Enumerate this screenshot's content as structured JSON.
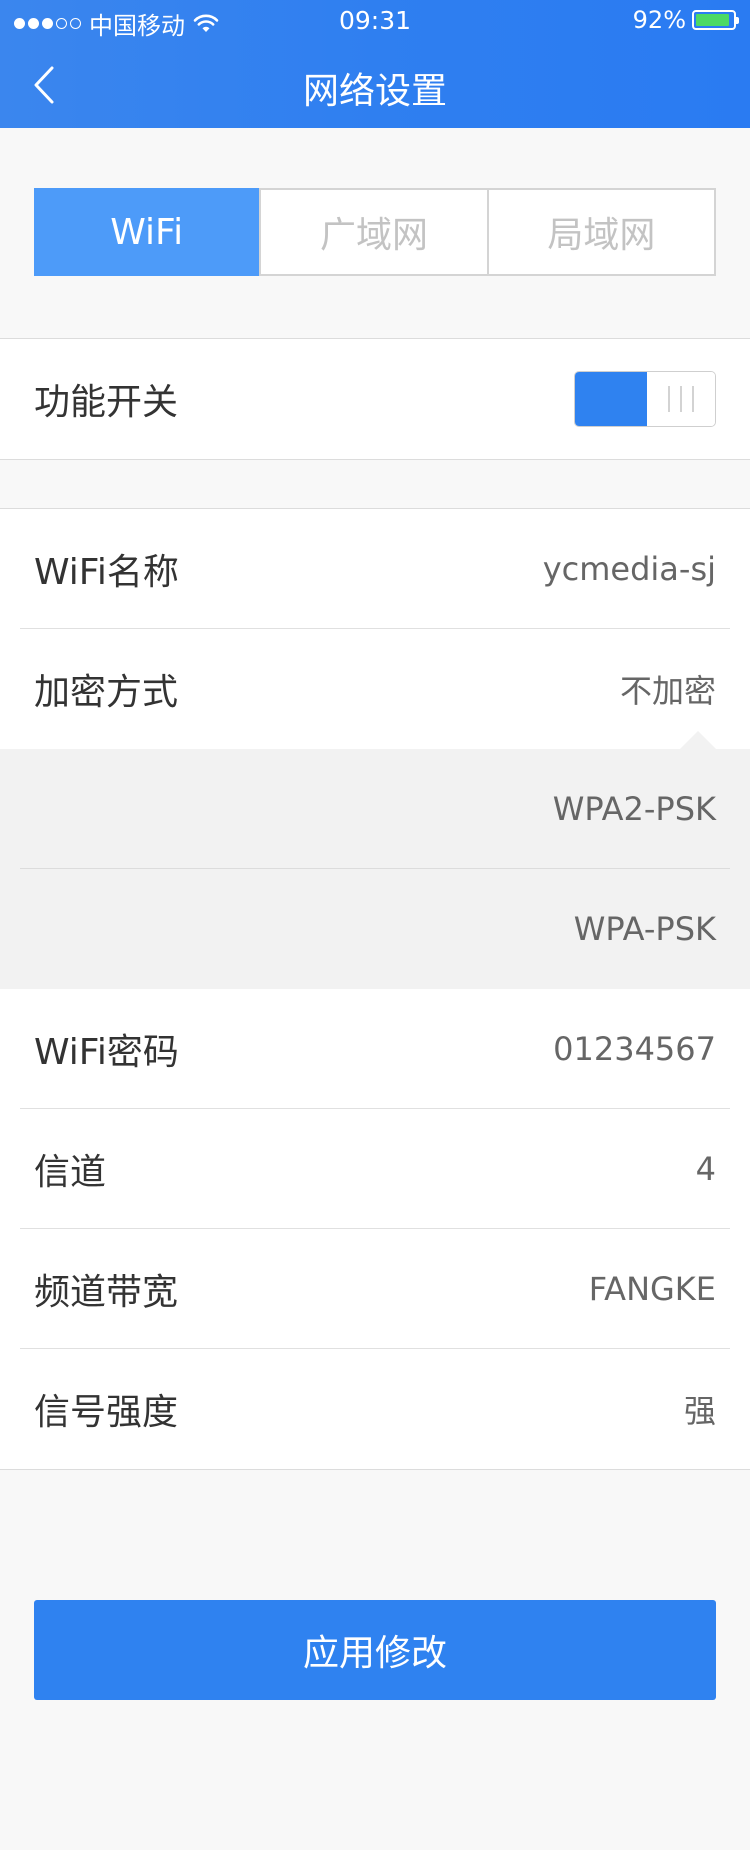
{
  "status_bar": {
    "carrier": "中国移动",
    "time": "09:31",
    "battery": "92%",
    "battery_level": 0.92,
    "signal_strength": 3,
    "signal_max": 5,
    "icons": [
      "signal-dots-icon",
      "wifi-icon",
      "battery-icon"
    ]
  },
  "header": {
    "title": "网络设置",
    "back_icon": "chevron-left-icon"
  },
  "tabs": [
    {
      "label": "WiFi",
      "active": true
    },
    {
      "label": "广域网",
      "active": false
    },
    {
      "label": "局域网",
      "active": false
    }
  ],
  "function_switch": {
    "label": "功能开关",
    "enabled": true
  },
  "settings": {
    "wifi_name": {
      "label": "WiFi名称",
      "value": "ycmedia-sj"
    },
    "encryption": {
      "label": "加密方式",
      "value": "不加密",
      "options": [
        "WPA2-PSK",
        "WPA-PSK"
      ]
    },
    "wifi_password": {
      "label": "WiFi密码",
      "value": "01234567"
    },
    "channel": {
      "label": "信道",
      "value": "4"
    },
    "bandwidth": {
      "label": "频道带宽",
      "value": "FANGKE"
    },
    "signal": {
      "label": "信号强度",
      "value": "强"
    }
  },
  "apply_button": {
    "label": "应用修改"
  },
  "colors": {
    "primary": "#2f82f0",
    "tab_active": "#4d9bf9",
    "background": "#f8f8f8",
    "battery_green": "#4cd964"
  }
}
